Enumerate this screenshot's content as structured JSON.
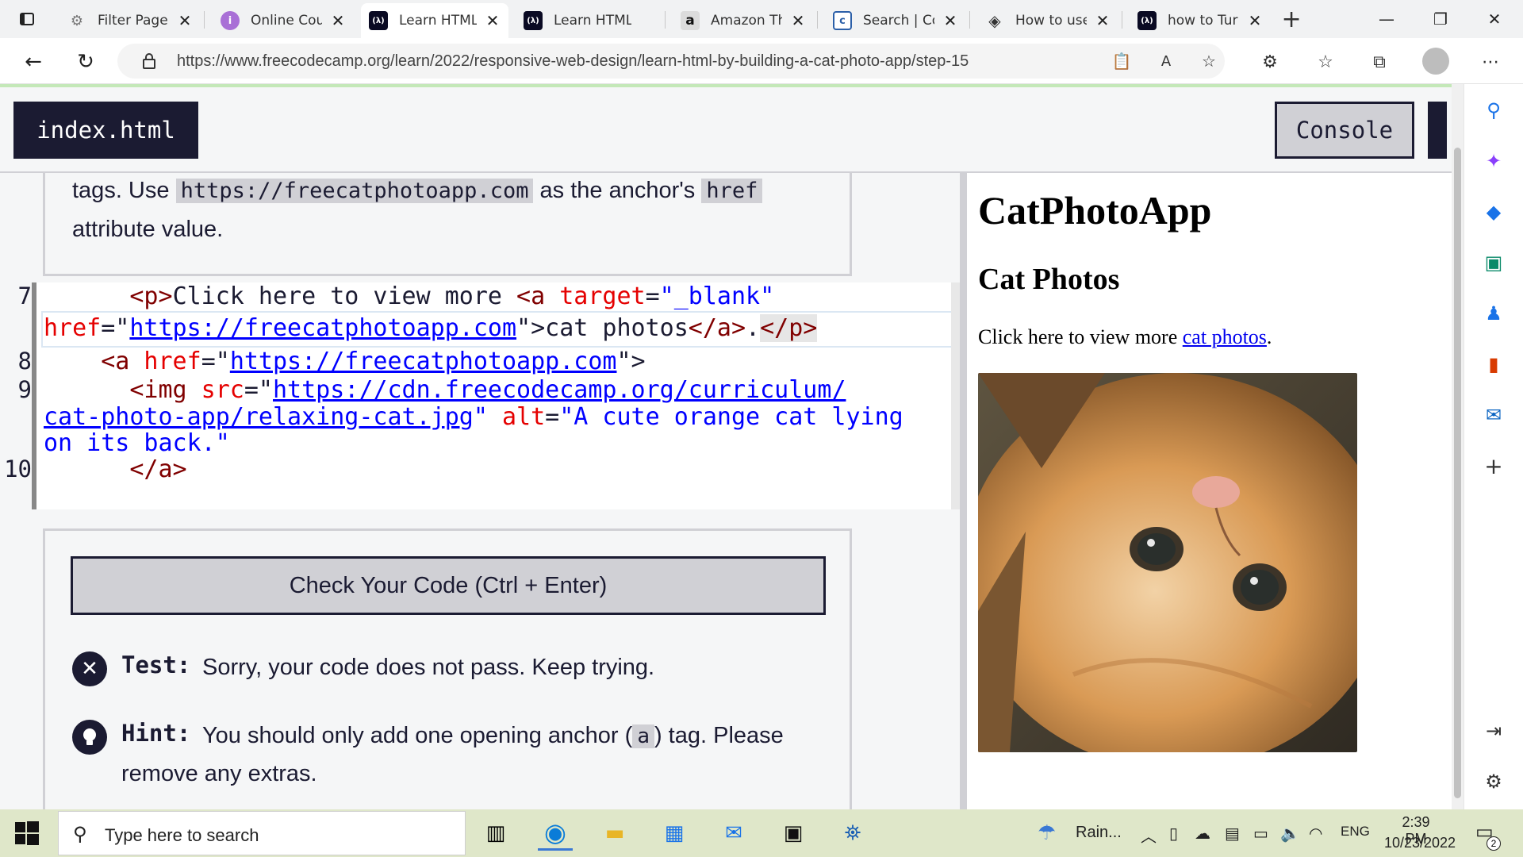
{
  "browser": {
    "tabs": [
      {
        "title": "Filter Page",
        "favicon": "⚙",
        "icon_name": "puzzle-icon",
        "color": "#7a7a7a"
      },
      {
        "title": "Online Cou",
        "favicon": "i",
        "icon_name": "online-course-icon",
        "color": "#a970d6"
      },
      {
        "title": "Learn HTML",
        "favicon": "(λ)",
        "icon_name": "freecodecamp-icon",
        "color": "#0a0a23",
        "active": true
      },
      {
        "title": "Learn HTML",
        "favicon": "(λ)",
        "icon_name": "freecodecamp-icon",
        "color": "#0a0a23"
      },
      {
        "title": "Amazon Th",
        "favicon": "a",
        "icon_name": "amazon-icon",
        "color": "#d8d8d8"
      },
      {
        "title": "Search | Co",
        "favicon": "c",
        "icon_name": "search-site-icon",
        "color": "#2b5fa8"
      },
      {
        "title": "How to use",
        "favicon": "◈",
        "icon_name": "diamond-icon",
        "color": "#5a5a5a"
      },
      {
        "title": "how to Tur",
        "favicon": "(λ)",
        "icon_name": "freecodecamp-icon",
        "color": "#0a0a23"
      }
    ],
    "url": "https://www.freecodecamp.org/learn/2022/responsive-web-design/learn-html-by-building-a-cat-photo-app/step-15"
  },
  "fcc": {
    "file_tab": "index.html",
    "console_label": "Console",
    "description": {
      "line1_before": "tags. Use ",
      "line1_code": "https://freecatphotoapp.com",
      "line1_middle": " as the anchor's ",
      "line1_code2": "href",
      "line2": "attribute value."
    },
    "code_lines": [
      {
        "number": "7"
      },
      {
        "number": "8"
      },
      {
        "number": "9"
      },
      {
        "number": "10"
      }
    ],
    "code": {
      "l7a_indent": "      ",
      "l7a_p_open": "<p>",
      "l7a_text": "Click here to view more ",
      "l7a_a_open": "<a",
      "l7a_target_attr": " target",
      "l7a_eq": "=",
      "l7a_target_val": "\"_blank\"",
      "l7b_href_attr": "href",
      "l7b_eq": "=\"",
      "l7b_href_val": "https://freecatphotoapp.com",
      "l7b_close_q": "\"",
      "l7b_gt": ">",
      "l7b_text": "cat photos",
      "l7b_a_close": "</a>",
      "l7b_period": ".",
      "l7b_p_close": "</p>",
      "l8_indent": "    ",
      "l8_a_open": "<a",
      "l8_href_attr": " href",
      "l8_eq": "=\"",
      "l8_href_val": "https://freecatphotoapp.com",
      "l8_close": "\">",
      "l9a_indent": "      ",
      "l9a_img_open": "<img",
      "l9a_src_attr": " src",
      "l9a_eq": "=\"",
      "l9a_src_val": "https://cdn.freecodecamp.org/curriculum/",
      "l9b_src_val": "cat-photo-app/relaxing-cat.jpg",
      "l9b_close_q": "\"",
      "l9b_alt_attr": " alt",
      "l9b_eq": "=",
      "l9b_alt_val": "\"A cute orange cat lying",
      "l9c_alt_val": "on its back.\"",
      "l10_indent": "      ",
      "l10_a_close": "</a>"
    },
    "check_button": "Check Your Code (Ctrl + Enter)",
    "test_label": "Test:",
    "test_text": "Sorry, your code does not pass. Keep trying.",
    "hint_label": "Hint:",
    "hint_before": "You should only add one opening anchor (",
    "hint_code": "a",
    "hint_after": ") tag. Please",
    "hint_line2": "remove any extras."
  },
  "preview": {
    "h1": "CatPhotoApp",
    "h2": "Cat Photos",
    "p_text": "Click here to view more ",
    "link_text": "cat photos",
    "p_end": ".",
    "image_name": "relaxing-cat-photo"
  },
  "taskbar": {
    "search_placeholder": "Type here to search",
    "weather": "Rain...",
    "language": "ENG",
    "time": "2:39 PM",
    "date": "10/23/2022",
    "notifications": "2"
  }
}
